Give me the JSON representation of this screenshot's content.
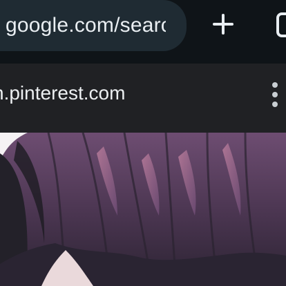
{
  "browser": {
    "url_display": "google.com/search",
    "new_tab_icon": "plus-icon",
    "tab_switcher_icon": "tab-switcher-icon"
  },
  "site": {
    "domain": "n.pinterest.com",
    "more_icon": "more-vert-icon"
  },
  "content": {
    "image_subject": "anime-hair-illustration"
  },
  "colors": {
    "toolbar_bg": "#0f1418",
    "url_pill_bg": "#1f2b33",
    "site_bar_bg": "#202124",
    "text_light": "#e9eef2"
  }
}
